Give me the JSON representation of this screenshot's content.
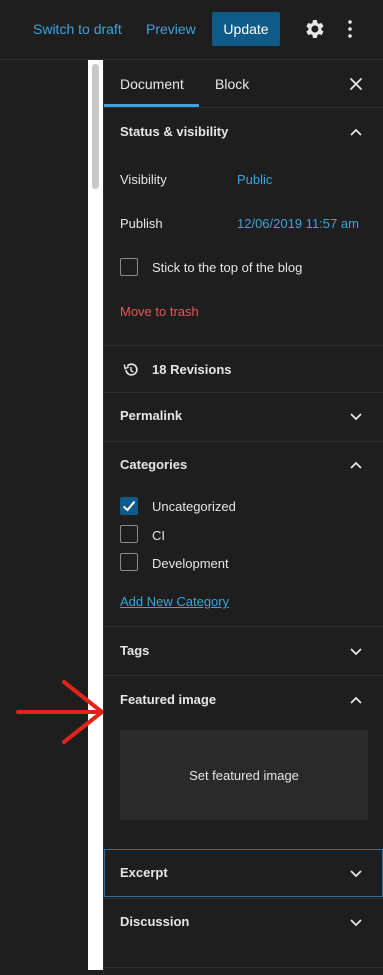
{
  "topbar": {
    "switch_to_draft": "Switch to draft",
    "preview": "Preview",
    "update": "Update",
    "settings_icon": "gear-icon",
    "more_icon": "kebab-menu-icon"
  },
  "tabs": {
    "document": "Document",
    "block": "Block",
    "close_icon": "close-icon"
  },
  "status": {
    "title": "Status & visibility",
    "visibility_label": "Visibility",
    "visibility_value": "Public",
    "publish_label": "Publish",
    "publish_value": "12/06/2019 11:57 am",
    "stick_label": "Stick to the top of the blog",
    "stick_checked": false,
    "trash": "Move to trash"
  },
  "revisions": {
    "label": "18 Revisions",
    "icon": "history-icon"
  },
  "permalink": {
    "title": "Permalink"
  },
  "categories": {
    "title": "Categories",
    "items": [
      {
        "label": "Uncategorized",
        "checked": true
      },
      {
        "label": "CI",
        "checked": false
      },
      {
        "label": "Development",
        "checked": false
      }
    ],
    "add_new": "Add New Category"
  },
  "tags": {
    "title": "Tags"
  },
  "featured": {
    "title": "Featured image",
    "button": "Set featured image"
  },
  "excerpt": {
    "title": "Excerpt"
  },
  "discussion": {
    "title": "Discussion"
  },
  "colors": {
    "accent": "#3ea3dc",
    "primary_button": "#0f5a86",
    "danger": "#e15a58",
    "annotation_arrow": "#e0241b"
  }
}
